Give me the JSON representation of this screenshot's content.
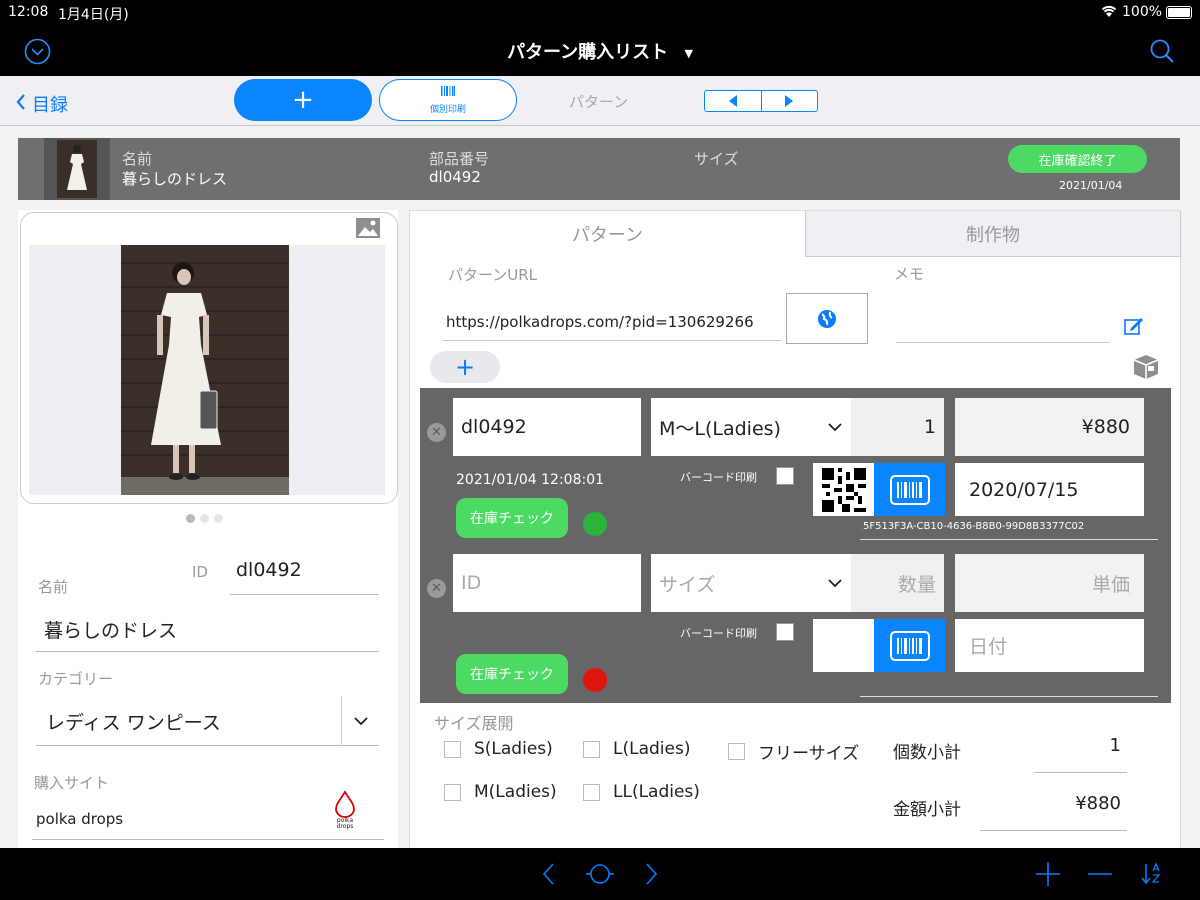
{
  "status": {
    "time": "12:08",
    "date": "1月4日(月)",
    "battery": "100%"
  },
  "nav": {
    "title": "パターン購入リスト"
  },
  "toolbar": {
    "back_label": "目録",
    "add_label": "+",
    "print_label": "個別印刷",
    "pattern_label": "パターン"
  },
  "header": {
    "name_label": "名前",
    "name_value": "暮らしのドレス",
    "part_label": "部品番号",
    "part_value": "dl0492",
    "size_label": "サイズ",
    "stock_button": "在庫確認終了",
    "stock_date": "2021/01/04"
  },
  "left": {
    "id_label": "ID",
    "id_value": "dl0492",
    "name_label": "名前",
    "name_value": "暮らしのドレス",
    "category_label": "カテゴリー",
    "category_value": "レディス ワンピース",
    "site_label": "購入サイト",
    "site_value": "polka drops",
    "site_logo_text": "polka drops"
  },
  "tabs": {
    "pattern": "パターン",
    "product": "制作物"
  },
  "pattern": {
    "url_label": "パターンURL",
    "url_value": "https://polkadrops.com/?pid=130629266",
    "memo_label": "メモ",
    "add_label": "+"
  },
  "rows": [
    {
      "id": "dl0492",
      "size": "M〜L(Ladies)",
      "qty": "1",
      "price": "¥880",
      "timestamp": "2021/01/04 12:08:01",
      "barcode_label": "バーコード印刷",
      "date": "2020/07/15",
      "uuid": "5F513F3A-CB10-4636-B8B0-99D8B3377C02",
      "stock_button": "在庫チェック",
      "status_color": "#2ab53a"
    },
    {
      "id_placeholder": "ID",
      "size_placeholder": "サイズ",
      "qty_placeholder": "数量",
      "price_placeholder": "単価",
      "barcode_label": "バーコード印刷",
      "date_placeholder": "日付",
      "stock_button": "在庫チェック",
      "status_color": "#e0160e"
    }
  ],
  "sizes": {
    "label": "サイズ展開",
    "options": [
      "S(Ladies)",
      "L(Ladies)",
      "フリーサイズ",
      "M(Ladies)",
      "LL(Ladies)"
    ],
    "count_label": "個数小計",
    "count_value": "1",
    "amount_label": "金額小計",
    "amount_value": "¥880"
  },
  "colors": {
    "accent": "#0a7aff",
    "green": "#4cd964",
    "header_gray": "#6f6f6f",
    "row_gray": "#666666"
  }
}
